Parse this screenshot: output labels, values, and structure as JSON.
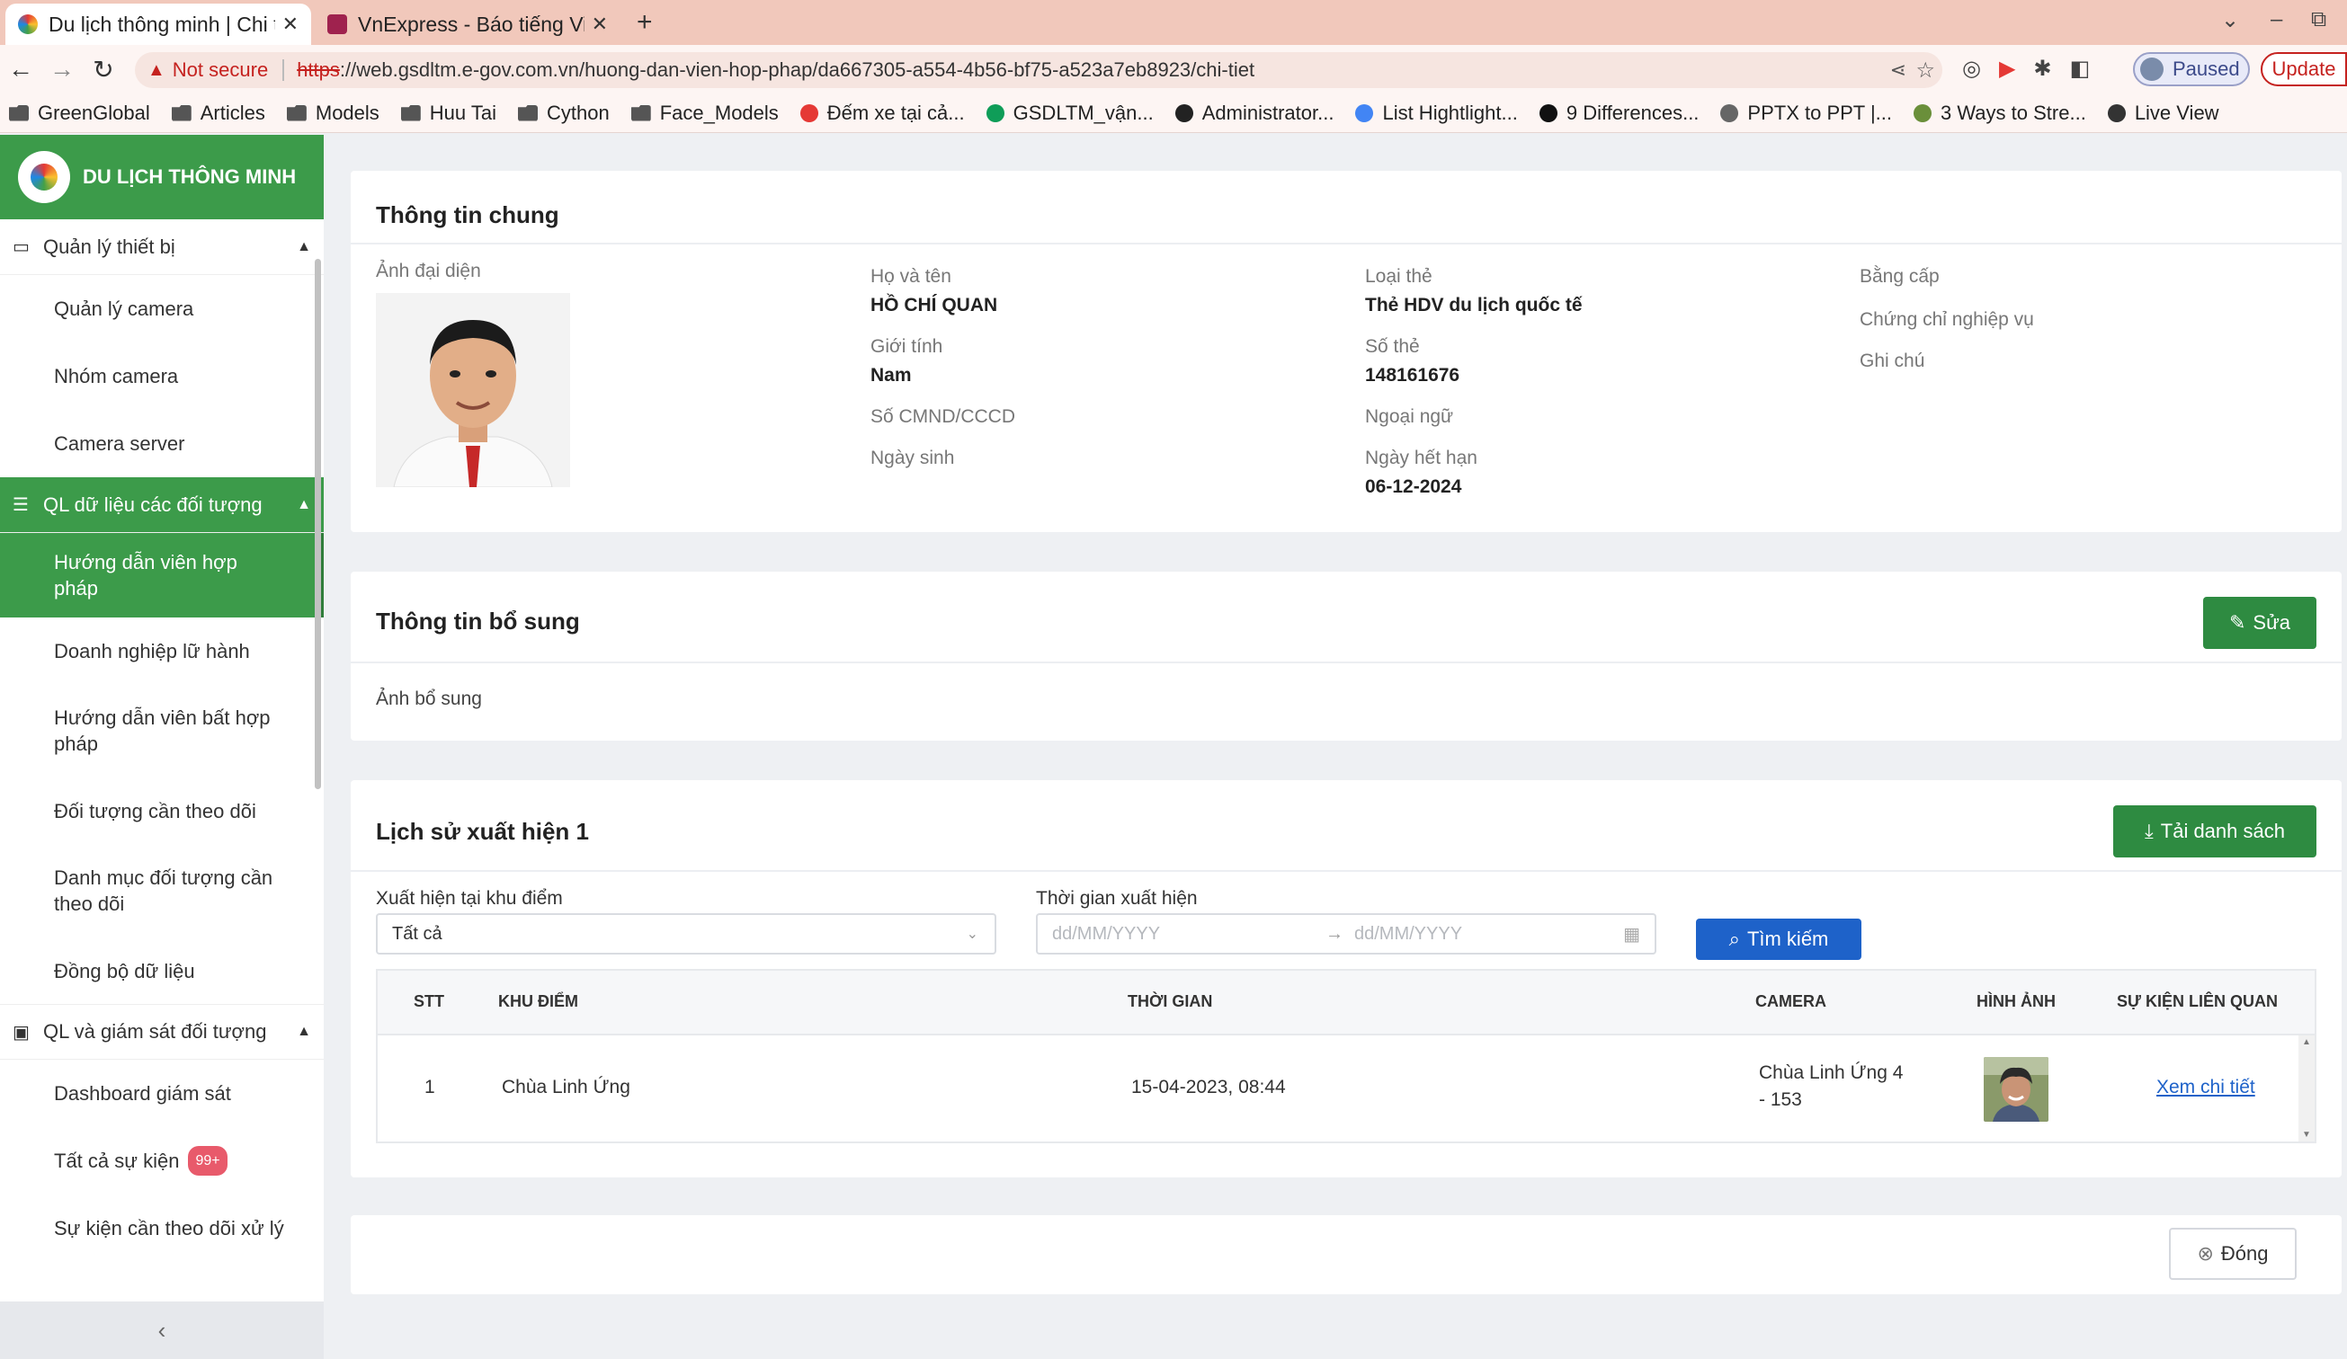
{
  "browser": {
    "tabs": [
      {
        "title": "Du lịch thông minh | Chi t"
      },
      {
        "title": "VnExpress - Báo tiếng Vi"
      }
    ],
    "security_label": "Not secure",
    "url_scheme": "https",
    "url_rest": "://web.gsdltm.e-gov.com.vn/huong-dan-vien-hop-phap/da667305-a554-4b56-bf75-a523a7eb8923/chi-tiet",
    "profile_label": "Paused",
    "update_label": "Update",
    "bookmarks": [
      {
        "label": "GreenGlobal",
        "icon": "folder-icon"
      },
      {
        "label": "Articles",
        "icon": "folder-icon"
      },
      {
        "label": "Models",
        "icon": "folder-icon"
      },
      {
        "label": "Huu Tai",
        "icon": "folder-icon"
      },
      {
        "label": "Cython",
        "icon": "folder-icon"
      },
      {
        "label": "Face_Models",
        "icon": "folder-icon"
      },
      {
        "label": "Đếm xe tại cả...",
        "icon": "youtube-icon"
      },
      {
        "label": "GSDLTM_vận...",
        "icon": "sheets-icon"
      },
      {
        "label": "Administrator...",
        "icon": "github-icon"
      },
      {
        "label": "List Hightlight...",
        "icon": "drive-icon"
      },
      {
        "label": "9 Differences...",
        "icon": "f-icon"
      },
      {
        "label": "PPTX to PPT |...",
        "icon": "cloud-icon"
      },
      {
        "label": "3 Ways to Stre...",
        "icon": "globe-icon"
      },
      {
        "label": "Live View",
        "icon": "camera-icon"
      }
    ]
  },
  "sidebar": {
    "brand": "DU LỊCH THÔNG MINH",
    "groups": [
      {
        "label": "Quản lý thiết bị",
        "icon": "laptop-icon",
        "items": [
          {
            "label": "Quản lý camera"
          },
          {
            "label": "Nhóm camera"
          },
          {
            "label": "Camera server"
          }
        ]
      },
      {
        "label": "QL dữ liệu các đối tượng",
        "icon": "database-icon",
        "items": [
          {
            "label": "Hướng dẫn viên hợp pháp"
          },
          {
            "label": "Doanh nghiệp lữ hành"
          },
          {
            "label": "Hướng dẫn viên bất hợp pháp"
          },
          {
            "label": "Đối tượng cần theo dõi"
          },
          {
            "label": "Danh mục đối tượng cần theo dõi"
          },
          {
            "label": "Đồng bộ dữ liệu"
          }
        ]
      },
      {
        "label": "QL và giám sát đối tượng",
        "icon": "monitor-icon",
        "items": [
          {
            "label": "Dashboard giám sát"
          },
          {
            "label": "Tất cả sự kiện",
            "badge": "99+"
          },
          {
            "label": "Sự kiện cần theo dõi xử lý"
          }
        ]
      }
    ]
  },
  "general": {
    "title": "Thông tin chung",
    "avatar_label": "Ảnh đại diện",
    "col1": [
      {
        "label": "Họ và tên",
        "value": "HỒ CHÍ QUAN"
      },
      {
        "label": "Giới tính",
        "value": "Nam"
      },
      {
        "label": "Số CMND/CCCD",
        "value": ""
      },
      {
        "label": "Ngày sinh",
        "value": ""
      }
    ],
    "col2": [
      {
        "label": "Loại thẻ",
        "value": "Thẻ HDV du lịch quốc tế"
      },
      {
        "label": "Số thẻ",
        "value": "148161676"
      },
      {
        "label": "Ngoại ngữ",
        "value": ""
      },
      {
        "label": "Ngày hết hạn",
        "value": "06-12-2024"
      }
    ],
    "col3": [
      {
        "label": "Bằng cấp"
      },
      {
        "label": "Chứng chỉ nghiệp vụ"
      },
      {
        "label": "Ghi chú"
      }
    ]
  },
  "additional": {
    "title": "Thông tin bổ sung",
    "edit_label": "Sửa",
    "photos_label": "Ảnh bổ sung"
  },
  "history": {
    "title": "Lịch sử xuất hiện 1",
    "download_label": "Tải danh sách",
    "location_label": "Xuất hiện tại khu điểm",
    "location_value": "Tất cả",
    "time_label": "Thời gian xuất hiện",
    "date_from_placeholder": "dd/MM/YYYY",
    "date_to_placeholder": "dd/MM/YYYY",
    "search_label": "Tìm kiếm",
    "columns": [
      "STT",
      "KHU ĐIỂM",
      "THỜI GIAN",
      "CAMERA",
      "HÌNH ẢNH",
      "SỰ KIỆN LIÊN QUAN"
    ],
    "rows": [
      {
        "stt": "1",
        "location": "Chùa Linh Ứng",
        "time": "15-04-2023, 08:44",
        "camera_line1": "Chùa Linh Ứng 4",
        "camera_line2": "- 153",
        "link": "Xem chi tiết"
      }
    ]
  },
  "footer": {
    "close_label": "Đóng"
  }
}
